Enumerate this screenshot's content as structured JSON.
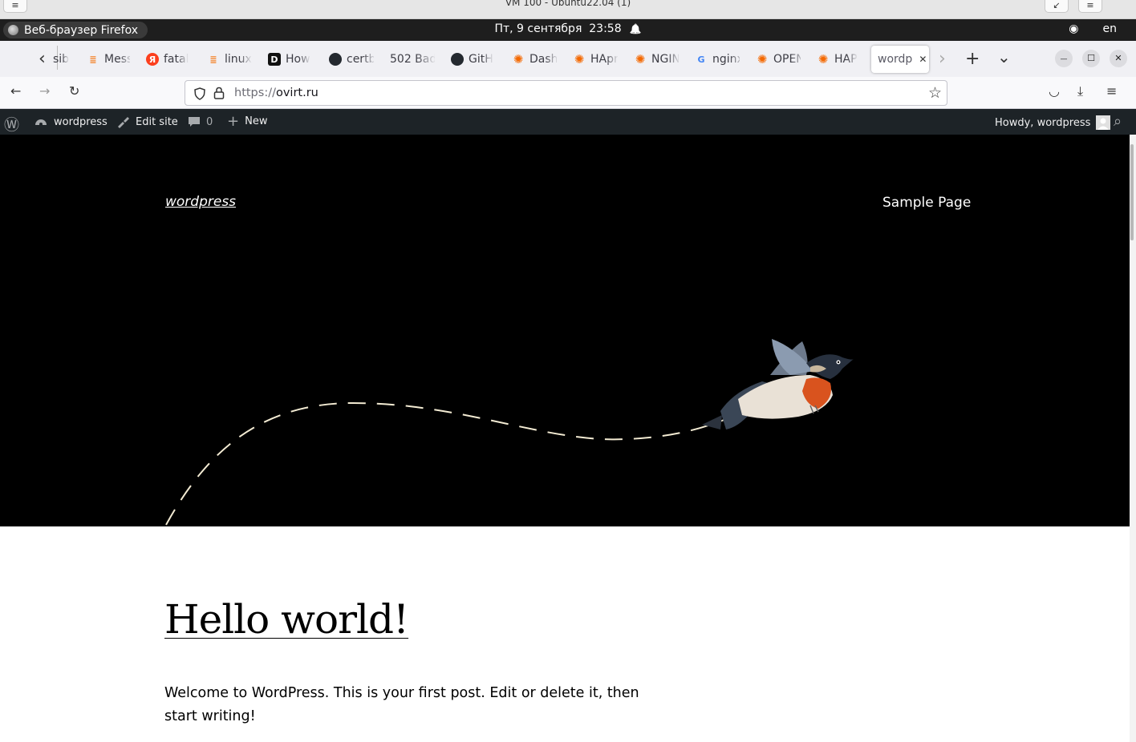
{
  "vm": {
    "title": "VM 100 - Ubuntu22.04 (1)",
    "minimize_glyph": "↙",
    "menu_glyph": "≡"
  },
  "gnome": {
    "activity_label": "Веб-браузер Firefox",
    "clock": "Пт, 9 сентября  23:58",
    "bell_icon": "🔔",
    "accessibility_icon": "◉",
    "lang": "en"
  },
  "tabs": [
    {
      "title": "sib",
      "icon": "",
      "color": ""
    },
    {
      "title": "Mess",
      "icon": "≣",
      "color": "#f48024"
    },
    {
      "title": "fatal",
      "icon": "Я",
      "color": "#fc3f1d"
    },
    {
      "title": "linux",
      "icon": "≣",
      "color": "#f48024"
    },
    {
      "title": "How",
      "icon": "D",
      "color": "#111111"
    },
    {
      "title": "certb",
      "icon": "●",
      "color": "#24292f"
    },
    {
      "title": "502 Bad",
      "icon": "",
      "color": ""
    },
    {
      "title": "GitH",
      "icon": "●",
      "color": "#24292f"
    },
    {
      "title": "Dash",
      "icon": "✺",
      "color": "#f46800"
    },
    {
      "title": "HApr",
      "icon": "✺",
      "color": "#f46800"
    },
    {
      "title": "NGIN",
      "icon": "✺",
      "color": "#f46800"
    },
    {
      "title": "nginx",
      "icon": "G",
      "color": "#4285f4"
    },
    {
      "title": "OPEN",
      "icon": "✺",
      "color": "#f46800"
    },
    {
      "title": "HAP",
      "icon": "✺",
      "color": "#f46800"
    },
    {
      "title": "wordp",
      "icon": "",
      "color": ""
    }
  ],
  "tab_controls": {
    "scroll_left": "‹",
    "scroll_right": "›",
    "new_tab": "+",
    "list_all": "⌄",
    "close_tab": "✕"
  },
  "window_controls": {
    "minimize": "—",
    "maximize": "☐",
    "close": "✕"
  },
  "nav": {
    "back": "←",
    "forward": "→",
    "reload": "↻",
    "url_prefix": "https://",
    "url_domain": "ovirt.ru",
    "bookmark_icon": "☆",
    "pocket_icon": "◡",
    "download_icon": "⤓",
    "menu_icon": "≡"
  },
  "wp_admin": {
    "logo_icon": "Ⓦ",
    "site_name": "wordpress",
    "edit_site": "Edit site",
    "comments_count": "0",
    "new_label": "New",
    "howdy": "Howdy, wordpress",
    "search_icon": "⌕"
  },
  "site": {
    "title": "wordpress",
    "nav_item": "Sample Page"
  },
  "post": {
    "title": "Hello world!",
    "body": "Welcome to WordPress. This is your first post. Edit or delete it, then start writing!"
  },
  "colors": {
    "admin_bar": "#1d2327",
    "hero_bg": "#000000",
    "dash_line": "#f3ebd3"
  }
}
